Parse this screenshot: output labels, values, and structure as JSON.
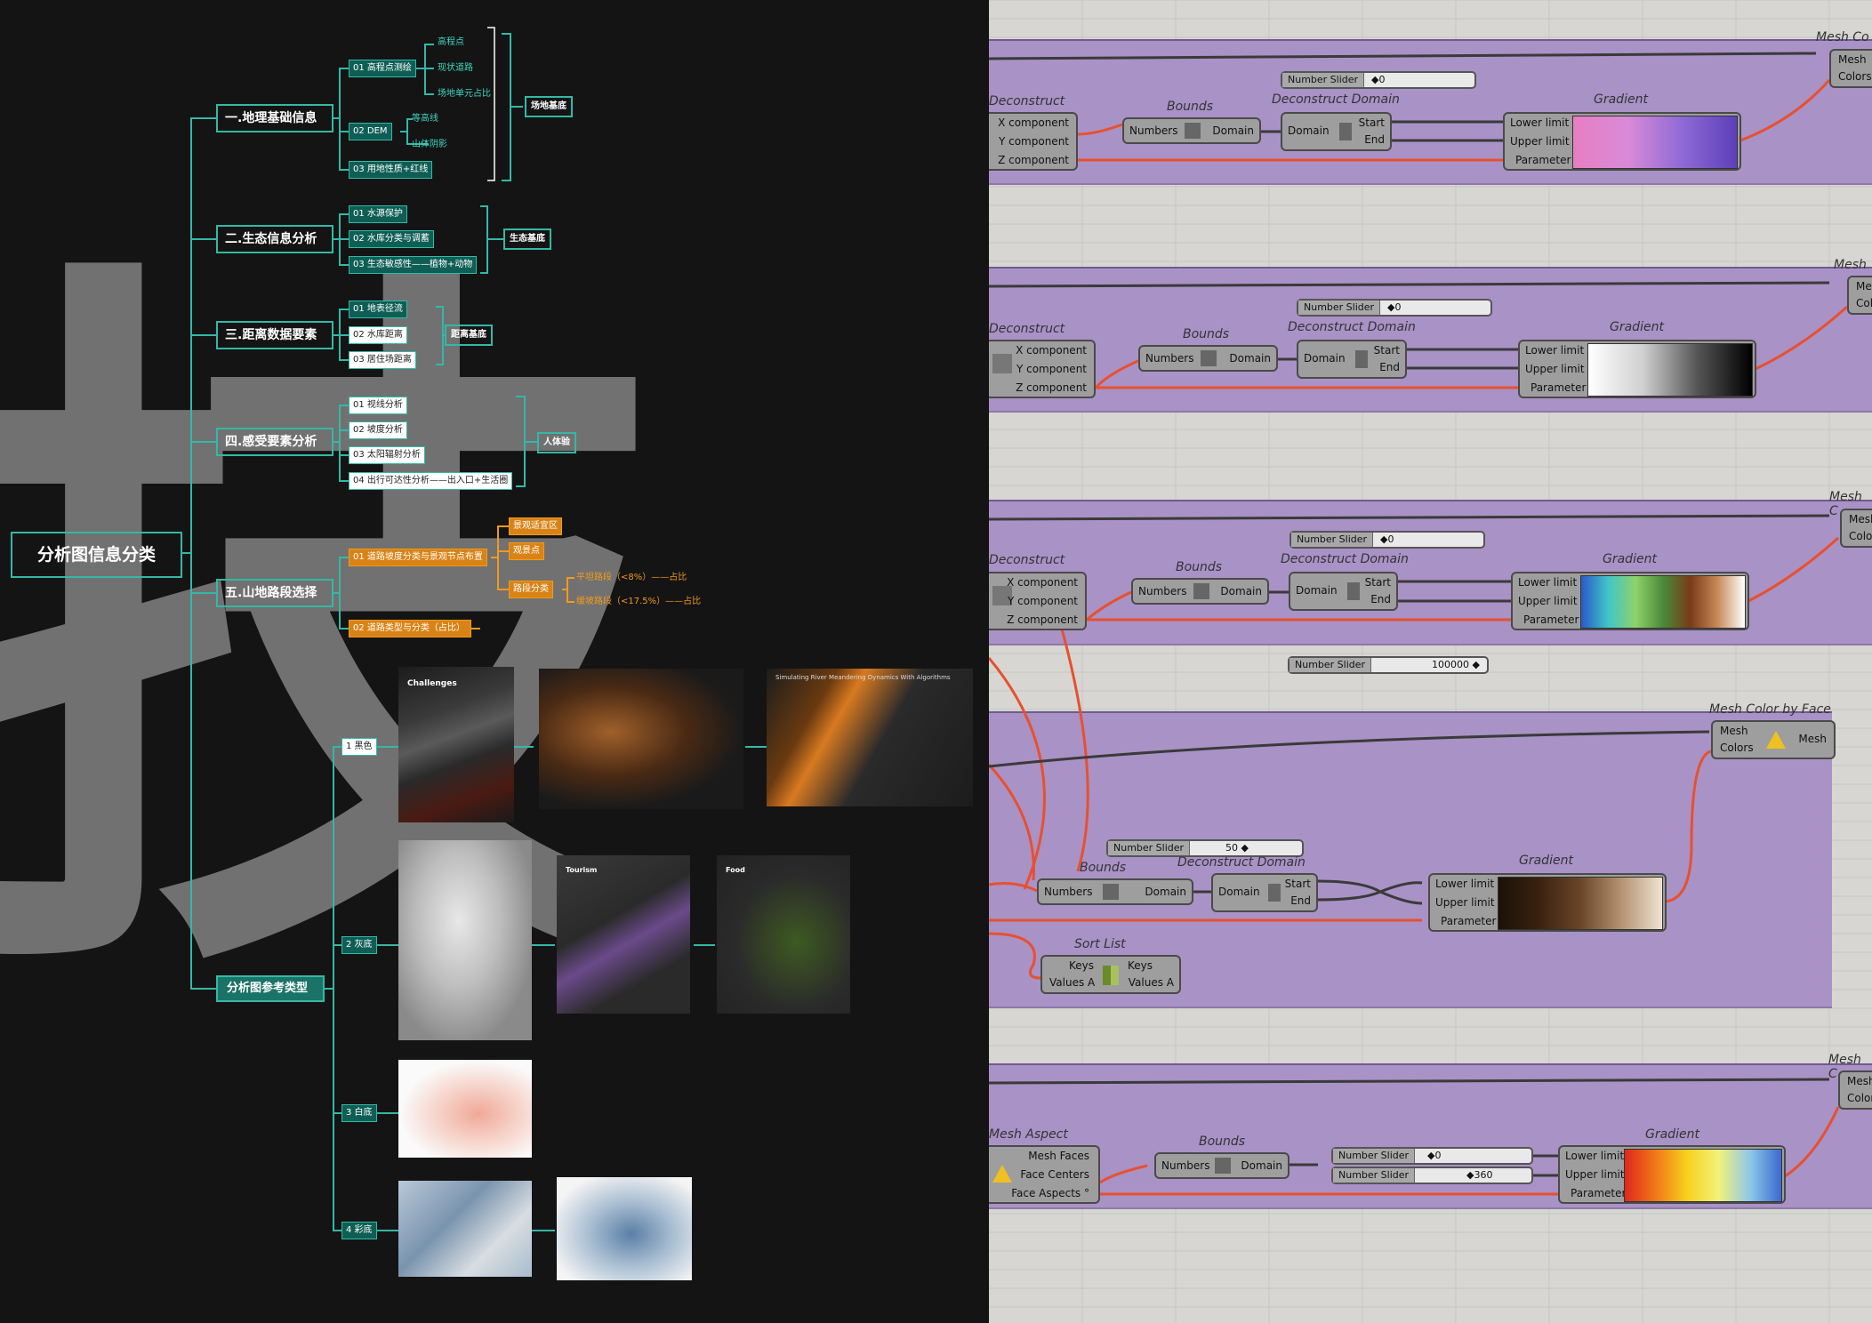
{
  "mindmap": {
    "root": "分析图信息分类",
    "watermark": "技",
    "sections": [
      {
        "label": "一.地理基础信息",
        "items": [
          {
            "label": "01 高程点测绘",
            "subs": [
              "高程点",
              "现状道路",
              "场地单元占比"
            ]
          },
          {
            "label": "02 DEM",
            "subs": [
              "等高线",
              "山体阴影"
            ]
          },
          {
            "label": "03 用地性质+红线",
            "subs": []
          }
        ],
        "group": "场地基底"
      },
      {
        "label": "二.生态信息分析",
        "items": [
          "01 水源保护",
          "02 水库分类与调蓄",
          "03 生态敏感性——植物+动物"
        ],
        "group": "生态基底"
      },
      {
        "label": "三.距离数据要素",
        "items": [
          "01 地表径流",
          "02 水库距离",
          "03 居住场距离"
        ],
        "group": "距离基底"
      },
      {
        "label": "四.感受要素分析",
        "items": [
          "01 视线分析",
          "02 坡度分析",
          "03 太阳辐射分析",
          "04 出行可达性分析——出入口+生活圈"
        ],
        "group": "人体验"
      },
      {
        "label": "五.山地路段选择",
        "items": [
          {
            "label": "01 道路坡度分类与景观节点布置",
            "subs": [
              "景观适宜区",
              "观景点",
              "路段分类"
            ],
            "grades": [
              "平坦路段（<8%）——占比",
              "缓坡路段（<17.5%）——占比"
            ]
          },
          {
            "label": "02 道路类型与分类（占比）"
          }
        ]
      }
    ],
    "reference": {
      "label": "分析图参考类型",
      "types": [
        "1 黑色",
        "2 灰底",
        "3 白底",
        "4 彩底"
      ],
      "thumb_texts": [
        "Challenges",
        "Simulating River Meandering Dynamics With Algorithms",
        "Tourism",
        "Food"
      ]
    }
  },
  "grasshopper": {
    "panels": [
      {
        "deconstruct": "Deconstruct",
        "deconstruct_outputs": [
          "X component",
          "Y component",
          "Z component"
        ],
        "bounds": "Bounds",
        "bounds_ports": [
          "Numbers",
          "Domain"
        ],
        "slider": {
          "label": "Number Slider",
          "value": "◆0"
        },
        "domain": "Deconstruct Domain",
        "domain_ports": [
          "Domain",
          "Start",
          "End"
        ],
        "gradient": "Gradient",
        "gradient_ports": [
          "Lower limit",
          "Upper limit",
          "Parameter"
        ],
        "mesh_caption": "Mesh Co",
        "mesh_ports": [
          "Mesh",
          "Colors"
        ],
        "gradient_colors": [
          "#e77ec2",
          "#d98ad8",
          "#8e6ad6",
          "#5d3fb8"
        ]
      },
      {
        "deconstruct": "Deconstruct",
        "deconstruct_outputs": [
          "X component",
          "Y component",
          "Z component"
        ],
        "bounds": "Bounds",
        "bounds_ports": [
          "Numbers",
          "Domain"
        ],
        "slider": {
          "label": "Number Slider",
          "value": "◆0"
        },
        "domain": "Deconstruct Domain",
        "domain_ports": [
          "Domain",
          "Start",
          "End"
        ],
        "gradient": "Gradient",
        "gradient_ports": [
          "Lower limit",
          "Upper limit",
          "Parameter"
        ],
        "mesh_caption": "Mesh",
        "mesh_ports": [
          "Mes",
          "Colo"
        ],
        "gradient_colors": [
          "#ffffff",
          "#d0d0d0",
          "#555555",
          "#000000"
        ]
      },
      {
        "deconstruct": "Deconstruct",
        "deconstruct_outputs": [
          "X component",
          "Y component",
          "Z component"
        ],
        "bounds": "Bounds",
        "bounds_ports": [
          "Numbers",
          "Domain"
        ],
        "slider": {
          "label": "Number Slider",
          "value": "◆0"
        },
        "domain": "Deconstruct Domain",
        "domain_ports": [
          "Domain",
          "Start",
          "End"
        ],
        "gradient": "Gradient",
        "gradient_ports": [
          "Lower limit",
          "Upper limit",
          "Parameter"
        ],
        "mesh_caption": "Mesh C",
        "mesh_ports": [
          "Mesh",
          "Colors"
        ],
        "gradient_colors": [
          "#2a59c9",
          "#41c6c9",
          "#8ed26a",
          "#4a8a3a",
          "#7a3a18",
          "#c88a58",
          "#ffffff"
        ]
      },
      {
        "slider_top": {
          "label": "Number Slider",
          "value": "100000 ◆"
        },
        "mesh_color_caption": "Mesh Color by Face",
        "mesh_color_ports": [
          "Mesh",
          "Colors"
        ],
        "mesh_color_output": "Mesh",
        "slider": {
          "label": "Number Slider",
          "value": "50 ◆"
        },
        "bounds": "Bounds",
        "bounds_ports": [
          "Numbers",
          "Domain"
        ],
        "domain": "Deconstruct Domain",
        "domain_ports": [
          "Domain",
          "Start",
          "End"
        ],
        "gradient": "Gradient",
        "gradient_ports": [
          "Lower limit",
          "Upper limit",
          "Parameter"
        ],
        "sortlist": "Sort List",
        "sort_ports": [
          "Keys",
          "Values A",
          "Keys",
          "Values A"
        ],
        "gradient_colors": [
          "#1a1208",
          "#3a2210",
          "#6a4528",
          "#b59272",
          "#efe2d0"
        ]
      },
      {
        "aspect": "Mesh Aspect",
        "aspect_outputs": [
          "Mesh Faces",
          "Face Centers",
          "Face Aspects °"
        ],
        "bounds": "Bounds",
        "bounds_ports": [
          "Numbers",
          "Domain"
        ],
        "slider_a": {
          "label": "Number Slider",
          "value": "◆0"
        },
        "slider_b": {
          "label": "Number Slider",
          "value": "◆360"
        },
        "gradient": "Gradient",
        "gradient_ports": [
          "Lower limit",
          "Upper limit",
          "Parameter"
        ],
        "mesh_caption": "Mesh C",
        "mesh_ports": [
          "Mesh",
          "Colors"
        ],
        "gradient_colors": [
          "#e0281c",
          "#f07a18",
          "#f6d21c",
          "#f2f27a",
          "#8ec8e8",
          "#3a6ad0"
        ]
      }
    ]
  }
}
